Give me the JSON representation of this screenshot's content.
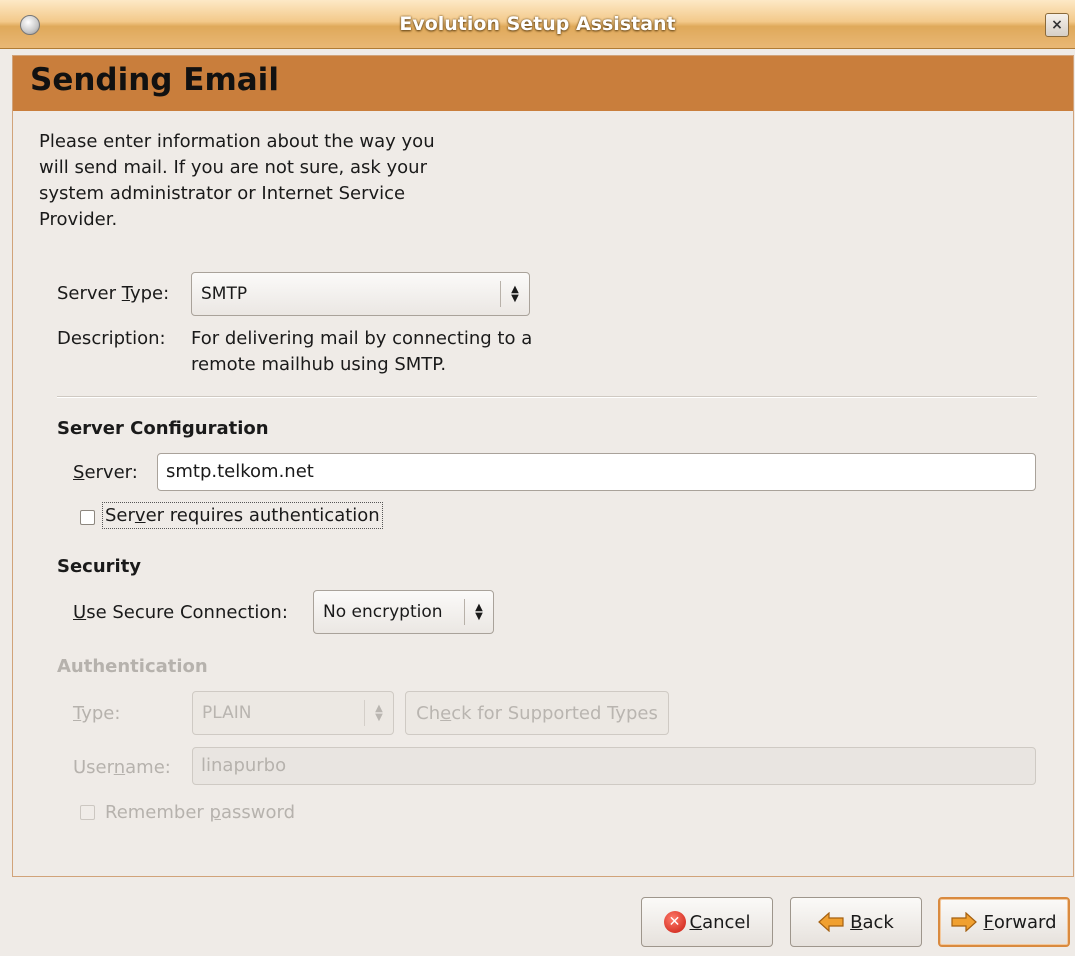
{
  "window": {
    "title": "Evolution Setup Assistant",
    "close_glyph": "×"
  },
  "page": {
    "title": "Sending Email",
    "intro_lines": [
      "Please enter information about the way you",
      "will send mail. If you are not sure, ask your",
      "system administrator or Internet Service",
      "Provider."
    ]
  },
  "server_type": {
    "label_pre": "Server ",
    "label_mnemonic": "T",
    "label_post": "ype:",
    "value": "SMTP",
    "description_label": "Description:",
    "description_lines": [
      "For delivering mail by connecting to a",
      "remote mailhub using SMTP."
    ]
  },
  "server_config": {
    "heading": "Server Configuration",
    "server_label_mnemonic": "S",
    "server_label_post": "erver:",
    "server_value": "smtp.telkom.net",
    "auth_checkbox_pre": "Ser",
    "auth_checkbox_mnemonic": "v",
    "auth_checkbox_post": "er requires authentication",
    "auth_checked": false
  },
  "security": {
    "heading": "Security",
    "label_mnemonic": "U",
    "label_post": "se Secure Connection:",
    "value": "No encryption"
  },
  "authentication": {
    "heading": "Authentication",
    "type_label_mnemonic": "T",
    "type_label_post": "ype:",
    "type_value": "PLAIN",
    "check_pre": "Ch",
    "check_mnemonic": "e",
    "check_post": "ck for Supported Types",
    "username_pre": "User",
    "username_mnemonic": "n",
    "username_post": "ame:",
    "username_value": "linapurbo",
    "remember_pre": "Remember ",
    "remember_mnemonic": "p",
    "remember_post": "assword",
    "remember_checked": false,
    "enabled": false
  },
  "buttons": {
    "cancel_mnemonic": "C",
    "cancel_post": "ancel",
    "back_mnemonic": "B",
    "back_post": "ack",
    "forward_mnemonic": "F",
    "forward_post": "orward"
  },
  "colors": {
    "header_band": "#c97e3c",
    "titlebar": "#e9b775",
    "arrow_icon": "#f0a030",
    "cancel_icon": "#d0231a"
  },
  "icons": {
    "app": "app-menu-icon",
    "close": "close-icon",
    "cancel": "cancel-icon",
    "back": "back-arrow-icon",
    "forward": "forward-arrow-icon"
  }
}
